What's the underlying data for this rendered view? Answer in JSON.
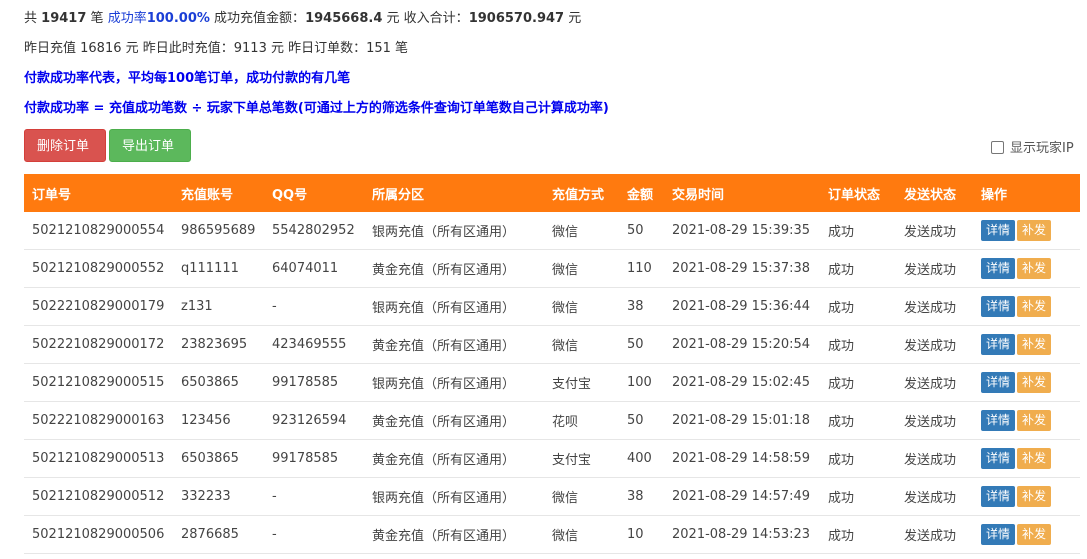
{
  "summary": {
    "prefix": "共",
    "total_count": "19417",
    "count_unit": "笔",
    "rate_label": "成功率",
    "rate_value": "100.00%",
    "amount_label": "成功充值金额：",
    "amount_value": "1945668.4",
    "amount_unit": "元",
    "income_label": "收入合计：",
    "income_value": "1906570.947",
    "income_unit": "元"
  },
  "yesterday": {
    "text": "昨日充值 16816 元 昨日此时充值：9113 元 昨日订单数：151 笔"
  },
  "notes": {
    "line1": "付款成功率代表，平均每100笔订单，成功付款的有几笔",
    "line2": "付款成功率 = 充值成功笔数 ÷ 玩家下单总笔数(可通过上方的筛选条件查询订单笔数自己计算成功率)"
  },
  "toolbar": {
    "delete_label": "删除订单",
    "export_label": "导出订单",
    "show_ip_label": "显示玩家IP"
  },
  "table": {
    "headers": [
      "订单号",
      "充值账号",
      "QQ号",
      "所属分区",
      "充值方式",
      "金额",
      "交易时间",
      "订单状态",
      "发送状态",
      "操作"
    ],
    "detail_label": "详情",
    "resend_label": "补发",
    "rows": [
      [
        "5021210829000554",
        "986595689",
        "5542802952",
        "银两充值（所有区通用）",
        "微信",
        "50",
        "2021-08-29 15:39:35",
        "成功",
        "发送成功"
      ],
      [
        "5021210829000552",
        "q111111",
        "64074011",
        "黄金充值（所有区通用）",
        "微信",
        "110",
        "2021-08-29 15:37:38",
        "成功",
        "发送成功"
      ],
      [
        "5022210829000179",
        "z131",
        "-",
        "银两充值（所有区通用）",
        "微信",
        "38",
        "2021-08-29 15:36:44",
        "成功",
        "发送成功"
      ],
      [
        "5022210829000172",
        "23823695",
        "423469555",
        "黄金充值（所有区通用）",
        "微信",
        "50",
        "2021-08-29 15:20:54",
        "成功",
        "发送成功"
      ],
      [
        "5021210829000515",
        "6503865",
        "99178585",
        "银两充值（所有区通用）",
        "支付宝",
        "100",
        "2021-08-29 15:02:45",
        "成功",
        "发送成功"
      ],
      [
        "5022210829000163",
        "123456",
        "923126594",
        "黄金充值（所有区通用）",
        "花呗",
        "50",
        "2021-08-29 15:01:18",
        "成功",
        "发送成功"
      ],
      [
        "5021210829000513",
        "6503865",
        "99178585",
        "黄金充值（所有区通用）",
        "支付宝",
        "400",
        "2021-08-29 14:58:59",
        "成功",
        "发送成功"
      ],
      [
        "5021210829000512",
        "332233",
        "-",
        "银两充值（所有区通用）",
        "微信",
        "38",
        "2021-08-29 14:57:49",
        "成功",
        "发送成功"
      ],
      [
        "5021210829000506",
        "2876685",
        "-",
        "黄金充值（所有区通用）",
        "微信",
        "10",
        "2021-08-29 14:53:23",
        "成功",
        "发送成功"
      ]
    ]
  },
  "colors": {
    "header_bg": "#ff7a0f",
    "delete_bg": "#d9534f",
    "export_bg": "#5cb85c",
    "detail_bg": "#337ab7",
    "resend_bg": "#f0ad4e",
    "note_text": "#0000ee"
  }
}
